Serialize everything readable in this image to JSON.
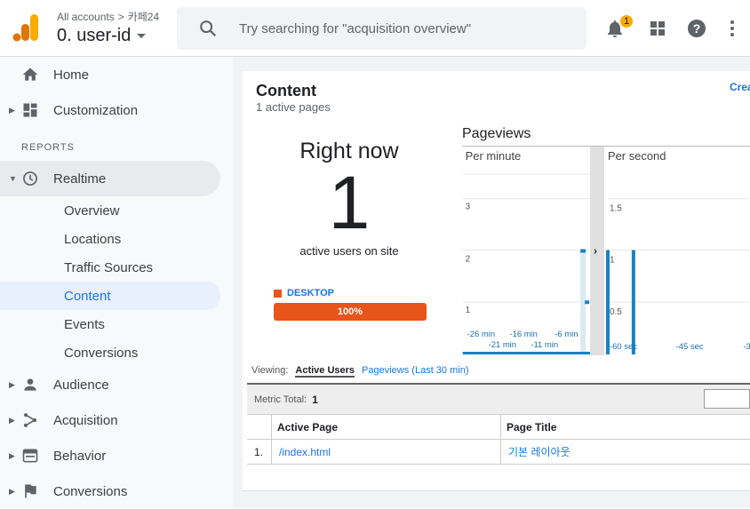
{
  "header": {
    "crumb_all": "All accounts",
    "crumb_sep": ">",
    "crumb_account": "카페24",
    "property": "0. user-id",
    "search_placeholder": "Try searching for \"acquisition overview\"",
    "notification_count": "1"
  },
  "sidebar": {
    "home": "Home",
    "customization": "Customization",
    "section": "REPORTS",
    "realtime": "Realtime",
    "realtime_items": [
      "Overview",
      "Locations",
      "Traffic Sources",
      "Content",
      "Events",
      "Conversions"
    ],
    "audience": "Audience",
    "acquisition": "Acquisition",
    "behavior": "Behavior",
    "conversions": "Conversions"
  },
  "content": {
    "title": "Content",
    "subtitle": "1 active pages",
    "create_link": "Crea",
    "right_now": "Right now",
    "active_users": "1",
    "active_label": "active users on site",
    "device_label": "DESKTOP",
    "device_percent": "100%",
    "device_share": 1.0,
    "pageviews_title": "Pageviews"
  },
  "chart_data": [
    {
      "type": "bar",
      "title": "Per minute",
      "y_ticks": [
        "3",
        "2",
        "1"
      ],
      "x_ticks_top": [
        "-26 min",
        "-16 min",
        "-6 min"
      ],
      "x_ticks_bottom": [
        "-21 min",
        "-11 min"
      ],
      "ylim": [
        0,
        3.5
      ]
    },
    {
      "type": "bar",
      "title": "Per second",
      "y_ticks": [
        "1.5",
        "1",
        "0.5"
      ],
      "x_ticks": [
        "-60 sec",
        "-45 sec",
        "-3"
      ],
      "ylim": [
        0,
        1.75
      ]
    }
  ],
  "viewing": {
    "label": "Viewing:",
    "active_tab": "Active Users",
    "other_tab": "Pageviews (Last 30 min)"
  },
  "table": {
    "metric_label": "Metric Total:",
    "metric_value": "1",
    "col_page": "Active Page",
    "col_title": "Page Title",
    "rows": [
      {
        "idx": "1.",
        "page": "/index.html",
        "title": "기본 레이아웃"
      }
    ]
  },
  "colors": {
    "accent": "#1a73e8",
    "desktop": "#e8551b",
    "chart_line": "#1a81c1"
  }
}
